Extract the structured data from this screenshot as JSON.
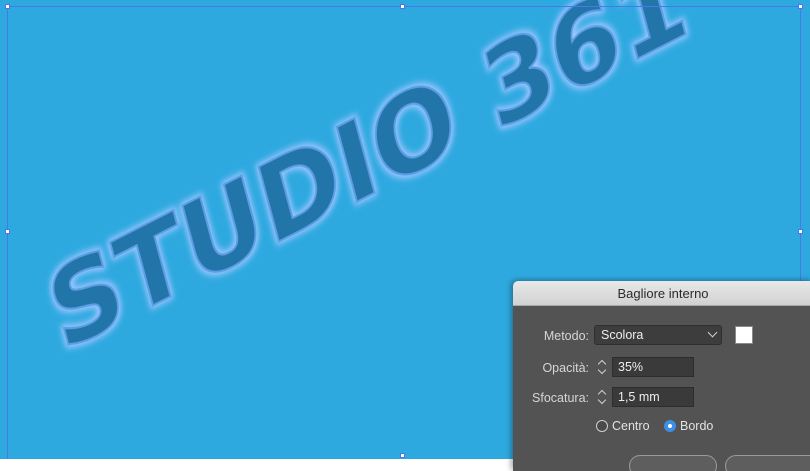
{
  "artwork": {
    "logo_text": "STUDIO 361°",
    "background_color": "#2ea9e0",
    "text_color": "#2274a8",
    "glow_color": "#9fc6ff",
    "selection_color": "#4a78e8"
  },
  "dialog": {
    "title": "Bagliore interno",
    "method": {
      "label": "Metodo:",
      "value": "Scolora"
    },
    "color_swatch": "#ffffff",
    "opacity": {
      "label": "Opacità:",
      "value": "35%"
    },
    "blur": {
      "label": "Sfocatura:",
      "value": "1,5 mm"
    },
    "source": {
      "options": [
        {
          "label": "Centro",
          "selected": false
        },
        {
          "label": "Bordo",
          "selected": true
        }
      ]
    }
  }
}
